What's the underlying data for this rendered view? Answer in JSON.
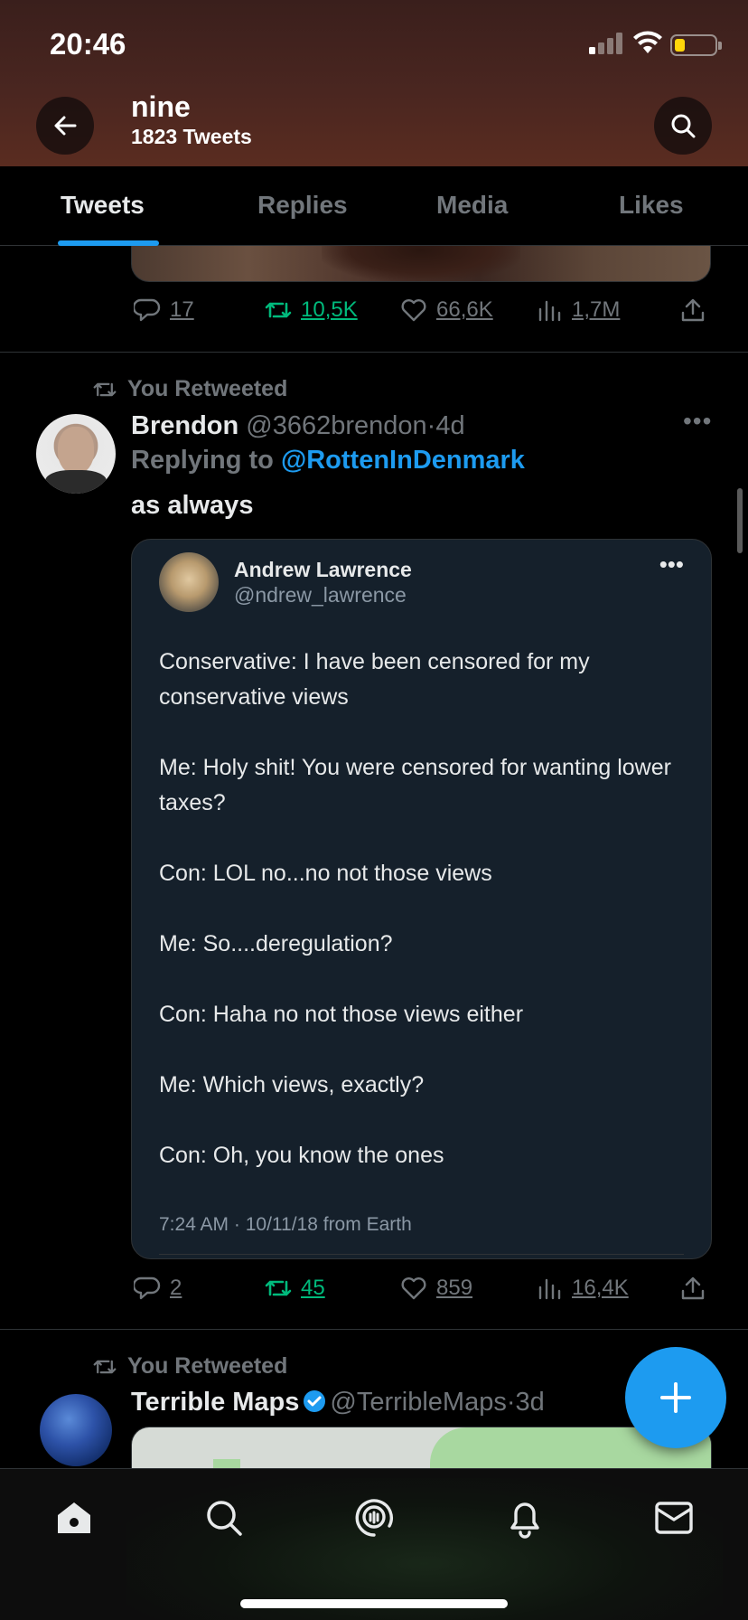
{
  "status_bar": {
    "time": "20:46"
  },
  "header": {
    "profile_name": "nine",
    "tweet_count": "1823 Tweets"
  },
  "tabs": [
    {
      "label": "Tweets",
      "active": true
    },
    {
      "label": "Replies",
      "active": false
    },
    {
      "label": "Media",
      "active": false
    },
    {
      "label": "Likes",
      "active": false
    }
  ],
  "tweet_prev": {
    "stats": {
      "replies": "17",
      "retweets": "10,5K",
      "likes": "66,6K",
      "views": "1,7M"
    }
  },
  "tweet_brendon": {
    "retweet_label": "You Retweeted",
    "name": "Brendon",
    "handle": "@3662brendon",
    "age": "4d",
    "replying_prefix": "Replying to",
    "replying_to": "@RottenInDenmark",
    "text": "as always",
    "quote": {
      "name": "Andrew Lawrence",
      "handle": "@ndrew_lawrence",
      "lines": [
        "Conservative: I have been censored for my conservative views",
        "Me: Holy shit! You were censored for wanting lower taxes?",
        "Con: LOL no...no not those views",
        "Me: So....deregulation?",
        "Con: Haha no not those views either",
        "Me: Which views, exactly?",
        "Con: Oh, you know the ones"
      ],
      "meta": "7:24 AM · 10/11/18 from Earth"
    },
    "stats": {
      "replies": "2",
      "retweets": "45",
      "likes": "859",
      "views": "16,4K"
    }
  },
  "tweet_terrible": {
    "retweet_label": "You Retweeted",
    "name": "Terrible Maps",
    "handle": "@TerribleMaps",
    "age": "3d"
  },
  "colors": {
    "accent": "#1d9bf0",
    "retweet_green": "#00ba7c",
    "muted": "#71767b"
  },
  "icons": {
    "nav": [
      "home-icon",
      "search-icon",
      "spaces-icon",
      "notifications-icon",
      "messages-icon"
    ]
  }
}
